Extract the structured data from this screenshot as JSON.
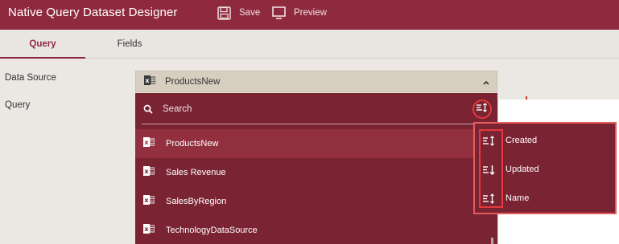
{
  "app": {
    "title": "Native Query Dataset Designer"
  },
  "toolbar": {
    "save_label": "Save",
    "preview_label": "Preview"
  },
  "tabs": [
    {
      "label": "Query",
      "active": true
    },
    {
      "label": "Fields",
      "active": false
    }
  ],
  "form": {
    "data_source_label": "Data Source",
    "query_label": "Query"
  },
  "data_source": {
    "selected": "ProductsNew",
    "icon": "excel-icon",
    "expanded": true
  },
  "dropdown": {
    "search": {
      "placeholder": "Search",
      "icon": "search-icon"
    },
    "items": [
      {
        "label": "ProductsNew",
        "selected": true
      },
      {
        "label": "Sales Revenue",
        "selected": false
      },
      {
        "label": "SalesByRegion",
        "selected": false
      },
      {
        "label": "TechnologyDataSource",
        "selected": false
      }
    ]
  },
  "sort_menu": {
    "options": [
      {
        "label": "Created",
        "icon": "sort-asc-icon"
      },
      {
        "label": "Updated",
        "icon": "sort-desc-icon"
      },
      {
        "label": "Name",
        "icon": "sort-asc-icon"
      }
    ]
  },
  "colors": {
    "accent": "#8f2a3e",
    "dropdown_bg": "#7a2332",
    "highlight": "#e33b3b"
  }
}
